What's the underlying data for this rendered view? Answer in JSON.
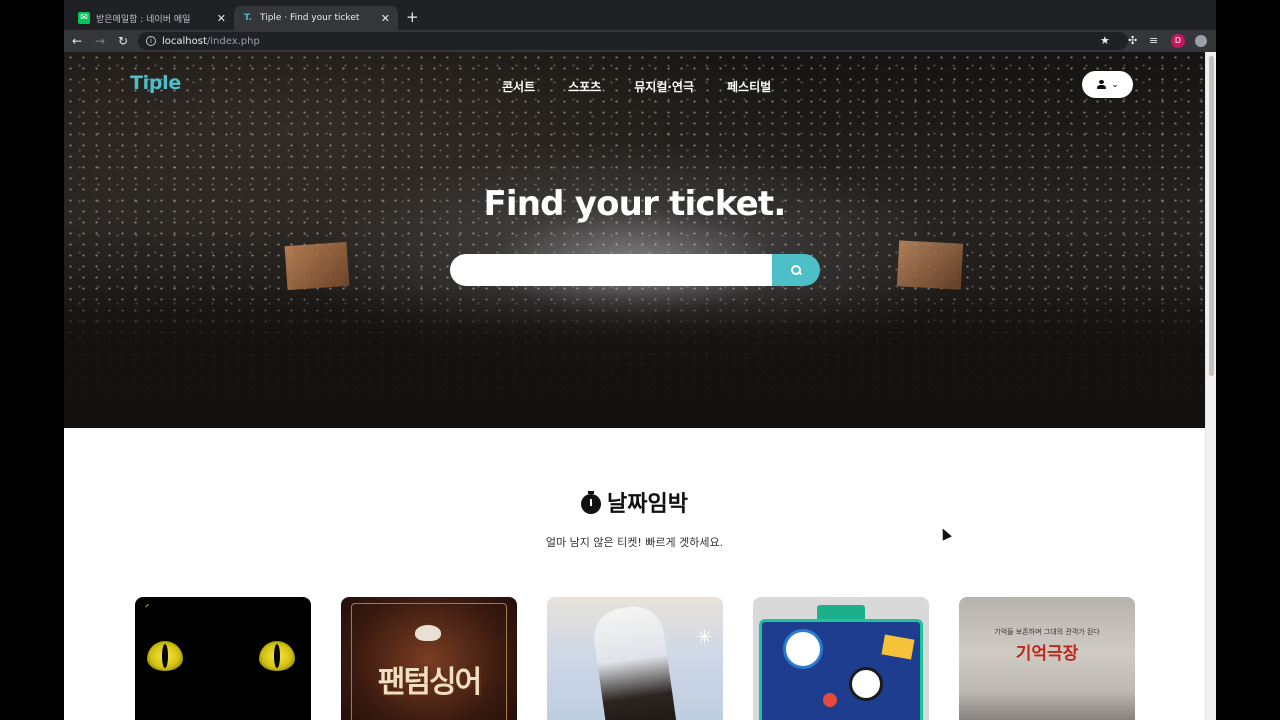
{
  "browser": {
    "tabs": [
      {
        "icon": "naver-mail-icon",
        "title": "받은메일함 : 네이버 메일",
        "close": "✕"
      },
      {
        "icon": "tiple-favicon",
        "title": "Tiple · Find your ticket",
        "close": "✕",
        "active": true
      }
    ],
    "new_tab": "+",
    "url_host": "localhost",
    "url_path": "/index.php",
    "profile_initial": "D"
  },
  "site": {
    "logo": "Tiple",
    "nav": [
      "콘서트",
      "스포츠",
      "뮤지컬·연극",
      "페스티벌"
    ],
    "hero_title": "Find your ticket.",
    "search": {
      "value": "",
      "placeholder": ""
    },
    "colors": {
      "accent": "#4dbfc9"
    }
  },
  "section": {
    "icon": "stopwatch-icon",
    "title": "날짜임박",
    "subtitle": "얼마 남지 않은 티켓! 빠르게 겟하세요."
  },
  "posters": [
    {
      "name": "cats-poster"
    },
    {
      "name": "phantom-singer-poster",
      "text": "팬텀싱어"
    },
    {
      "name": "album-poster"
    },
    {
      "name": "grand-mint-festival-poster"
    },
    {
      "name": "memory-theater-poster",
      "caption": "기억들 보존하며 그대의 관객가 된다",
      "text": "기억극장"
    }
  ]
}
